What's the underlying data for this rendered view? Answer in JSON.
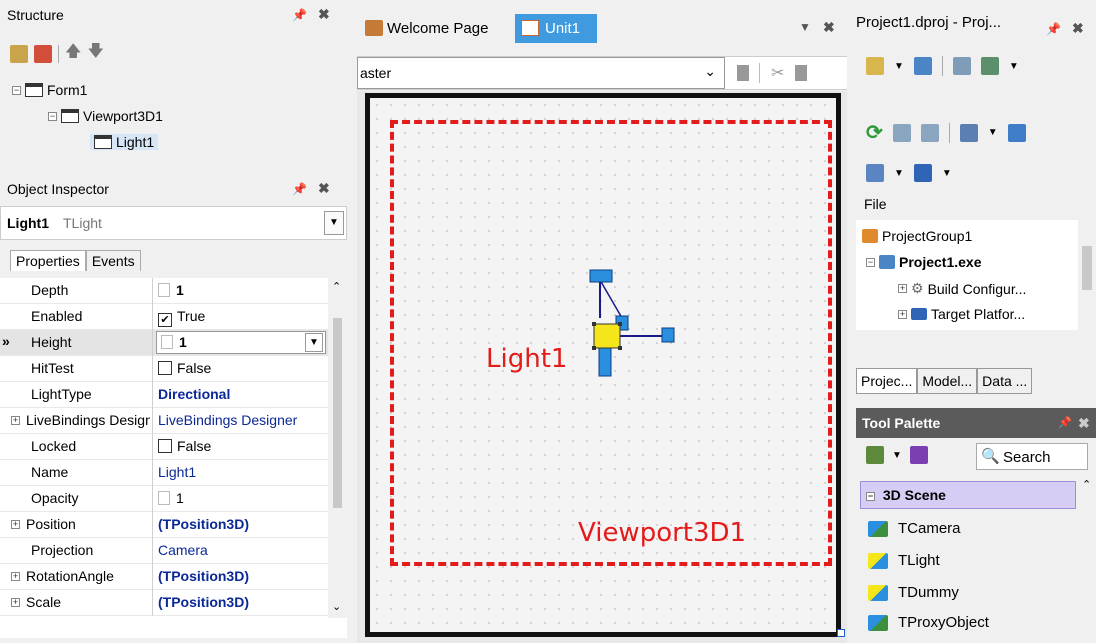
{
  "structure": {
    "title": "Structure",
    "tree": [
      {
        "label": "Form1",
        "expander": "−"
      },
      {
        "label": "Viewport3D1",
        "expander": "−"
      },
      {
        "label": "Light1"
      }
    ]
  },
  "inspector": {
    "title": "Object Inspector",
    "selected_name": "Light1",
    "selected_type": "TLight",
    "tabs": [
      "Properties",
      "Events"
    ],
    "properties": [
      {
        "name": "Depth",
        "value": "1",
        "kind": "spin-bold"
      },
      {
        "name": "Enabled",
        "value": "True",
        "kind": "check-on"
      },
      {
        "name": "Height",
        "value": "1",
        "kind": "spin-bold-combo",
        "marker": "»"
      },
      {
        "name": "HitTest",
        "value": "False",
        "kind": "check-off"
      },
      {
        "name": "LightType",
        "value": "Directional",
        "kind": "blue-bold"
      },
      {
        "name": "LiveBindings Designer",
        "value": "LiveBindings Designer",
        "kind": "blue",
        "expand": "+"
      },
      {
        "name": "Locked",
        "value": "False",
        "kind": "check-off"
      },
      {
        "name": "Name",
        "value": "Light1",
        "kind": "blue"
      },
      {
        "name": "Opacity",
        "value": "1",
        "kind": "spin"
      },
      {
        "name": "Position",
        "value": "(TPosition3D)",
        "kind": "blue-bold",
        "expand": "+"
      },
      {
        "name": "Projection",
        "value": "Camera",
        "kind": "blue"
      },
      {
        "name": "RotationAngle",
        "value": "(TPosition3D)",
        "kind": "blue-bold",
        "expand": "+"
      },
      {
        "name": "Scale",
        "value": "(TPosition3D)",
        "kind": "blue-bold",
        "expand": "+"
      }
    ]
  },
  "editor": {
    "tabs": [
      "Welcome Page",
      "Unit1"
    ],
    "view_combo_value": "aster",
    "viewport_label": "Viewport3D1",
    "light_label": "Light1"
  },
  "project": {
    "title": "Project1.dproj - Proj...",
    "file_header": "File",
    "tree": [
      "ProjectGroup1",
      "Project1.exe",
      "Build Configur...",
      "Target Platfor..."
    ],
    "bottom_tabs": [
      "Projec...",
      "Model...",
      "Data ..."
    ]
  },
  "palette": {
    "title": "Tool Palette",
    "search_label": "Search",
    "category": "3D Scene",
    "category_expander": "−",
    "items": [
      "TCamera",
      "TLight",
      "TDummy",
      "TProxyObject"
    ]
  },
  "icons": {
    "pin": "pin-icon",
    "close": "close-icon"
  },
  "colors": {
    "accent_red": "#e31b1b",
    "palette_header": "#5b5b5b",
    "category_bg": "#d7ccf3",
    "value_blue": "#0a2896"
  }
}
